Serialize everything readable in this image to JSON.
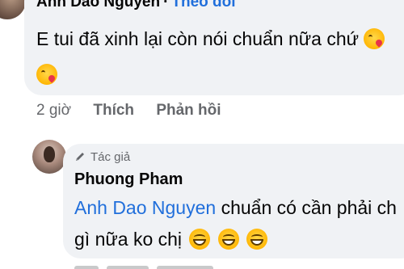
{
  "top_comment": {
    "author": "Anh Dao Nguyen",
    "separator": "·",
    "follow_label": "Theo dõi",
    "text": "E tui đã xinh lại còn nói chuẩn nữa chứ",
    "emoji_inline": "kiss-wink-emoji",
    "emoji_second_line": "kiss-wink-emoji",
    "time": "2 giờ",
    "like_label": "Thích",
    "reply_label": "Phản hồi"
  },
  "reply_comment": {
    "badge_label": "Tác giả",
    "author": "Phuong Pham",
    "mention": "Anh Dao Nguyen",
    "text_line1": " chuẩn có cần phải ch",
    "text_line2": "gì nữa ko chị",
    "emojis": [
      "grin-emoji",
      "grin-emoji",
      "grin-emoji"
    ]
  },
  "colors": {
    "link_blue": "#216fdb",
    "bubble_gray": "#f0f2f5",
    "secondary_text": "#65676b"
  }
}
